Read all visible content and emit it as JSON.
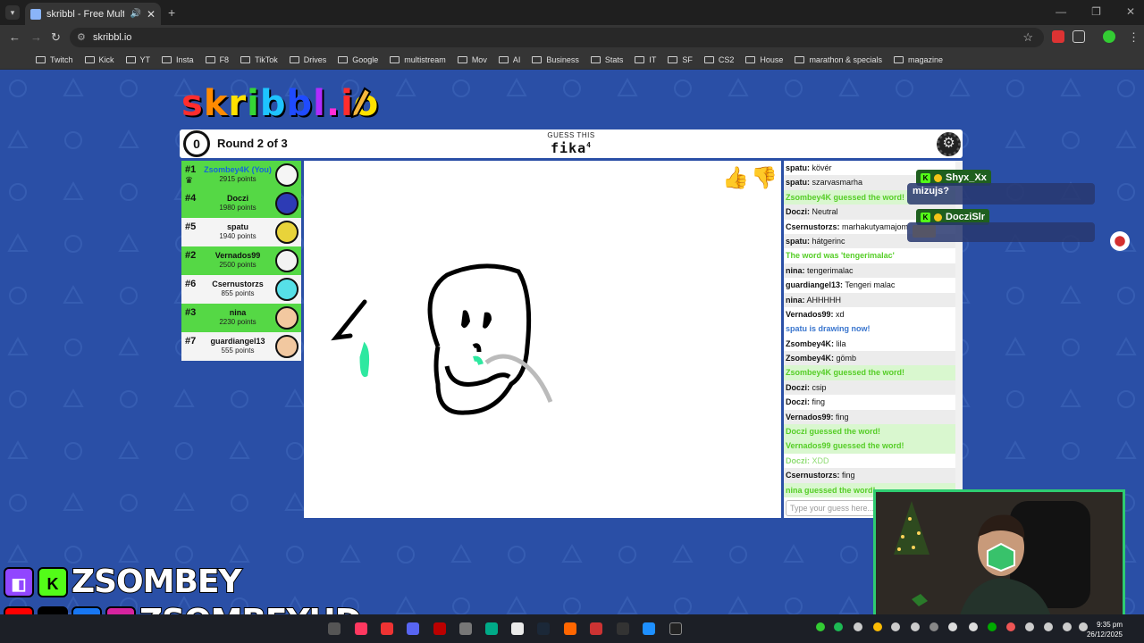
{
  "browser": {
    "tab_title": "skribbl - Free Multiplayer D",
    "url": "skribbl.io",
    "bookmarks": [
      "Twitch",
      "Kick",
      "YT",
      "Insta",
      "F8",
      "TikTok",
      "Drives",
      "Google",
      "multistream",
      "Mov",
      "AI",
      "Business",
      "Stats",
      "IT",
      "SF",
      "CS2",
      "House",
      "marathon & specials",
      "magazine"
    ]
  },
  "game": {
    "logo_text": "skribbl.io",
    "timer": "0",
    "round": "Round 2 of 3",
    "guess_label": "GUESS THIS",
    "word": "fika",
    "word_length": "4",
    "players": [
      {
        "rank": "#1",
        "name": "Zsombey4K (You)",
        "points": "2915 points",
        "style": "green",
        "you": true,
        "avatar_color": "#f5f5f5"
      },
      {
        "rank": "#4",
        "name": "Doczi",
        "points": "1980 points",
        "style": "green",
        "you": false,
        "avatar_color": "#2d3bb5"
      },
      {
        "rank": "#5",
        "name": "spatu",
        "points": "1940 points",
        "style": "white",
        "you": false,
        "avatar_color": "#e8d33a"
      },
      {
        "rank": "#2",
        "name": "Vernados99",
        "points": "2500 points",
        "style": "green",
        "you": false,
        "avatar_color": "#f3f3f3"
      },
      {
        "rank": "#6",
        "name": "Csernustorzs",
        "points": "855 points",
        "style": "white",
        "you": false,
        "avatar_color": "#56e0e8"
      },
      {
        "rank": "#3",
        "name": "nina",
        "points": "2230 points",
        "style": "green",
        "you": false,
        "avatar_color": "#f2c8a0"
      },
      {
        "rank": "#7",
        "name": "guardiangel13",
        "points": "555 points",
        "style": "white",
        "you": false,
        "avatar_color": "#f2c8a0"
      }
    ],
    "chat_placeholder": "Type your guess here...",
    "chat": [
      {
        "user": "spatu",
        "text": "kövér",
        "type": "user"
      },
      {
        "user": "spatu",
        "text": "szarvasmarha",
        "type": "user"
      },
      {
        "user": "",
        "text": "Zsombey4K guessed the word!",
        "type": "guess"
      },
      {
        "user": "Doczi",
        "text": "Neutral",
        "type": "user"
      },
      {
        "user": "Csernustorzs",
        "text": "marhakutyamajom",
        "type": "user"
      },
      {
        "user": "spatu",
        "text": "hátgerinc",
        "type": "user"
      },
      {
        "user": "",
        "text": "The word was 'tengerimalac'",
        "type": "info-green"
      },
      {
        "user": "nina",
        "text": "tengerimalac",
        "type": "user"
      },
      {
        "user": "guardiangel13",
        "text": "Tengeri malac",
        "type": "user"
      },
      {
        "user": "nina",
        "text": "AHHHHH",
        "type": "user"
      },
      {
        "user": "Vernados99",
        "text": "xd",
        "type": "user"
      },
      {
        "user": "",
        "text": "spatu is drawing now!",
        "type": "info-blue"
      },
      {
        "user": "Zsombey4K",
        "text": "lila",
        "type": "user"
      },
      {
        "user": "Zsombey4K",
        "text": "gömb",
        "type": "user"
      },
      {
        "user": "",
        "text": "Zsombey4K guessed the word!",
        "type": "guess"
      },
      {
        "user": "Doczi",
        "text": "csip",
        "type": "user"
      },
      {
        "user": "Doczi",
        "text": "fing",
        "type": "user"
      },
      {
        "user": "Vernados99",
        "text": "fing",
        "type": "user"
      },
      {
        "user": "",
        "text": "Doczi guessed the word!",
        "type": "guess"
      },
      {
        "user": "",
        "text": "Vernados99 guessed the word!",
        "type": "guess"
      },
      {
        "user": "Doczi",
        "text": "XDD",
        "type": "faded"
      },
      {
        "user": "Csernustorzs",
        "text": "fing",
        "type": "user"
      },
      {
        "user": "",
        "text": "nina guessed the word!",
        "type": "guess"
      }
    ]
  },
  "stream": {
    "overlay_messages": [
      {
        "user": "Shyx_Xx",
        "text": "mizujs?"
      },
      {
        "user": "DocziSlr",
        "text": ""
      }
    ],
    "brand_top": "ZSOMBEY",
    "brand_bottom": "ZSOMBEYHD"
  },
  "taskbar": {
    "time": "9:35 pm",
    "date": "26/12/2025"
  },
  "colors": {
    "page_bg": "#2a4fa6",
    "green_row": "#55d845",
    "guess_green": "#56ce27",
    "info_blue": "#3975ce"
  }
}
